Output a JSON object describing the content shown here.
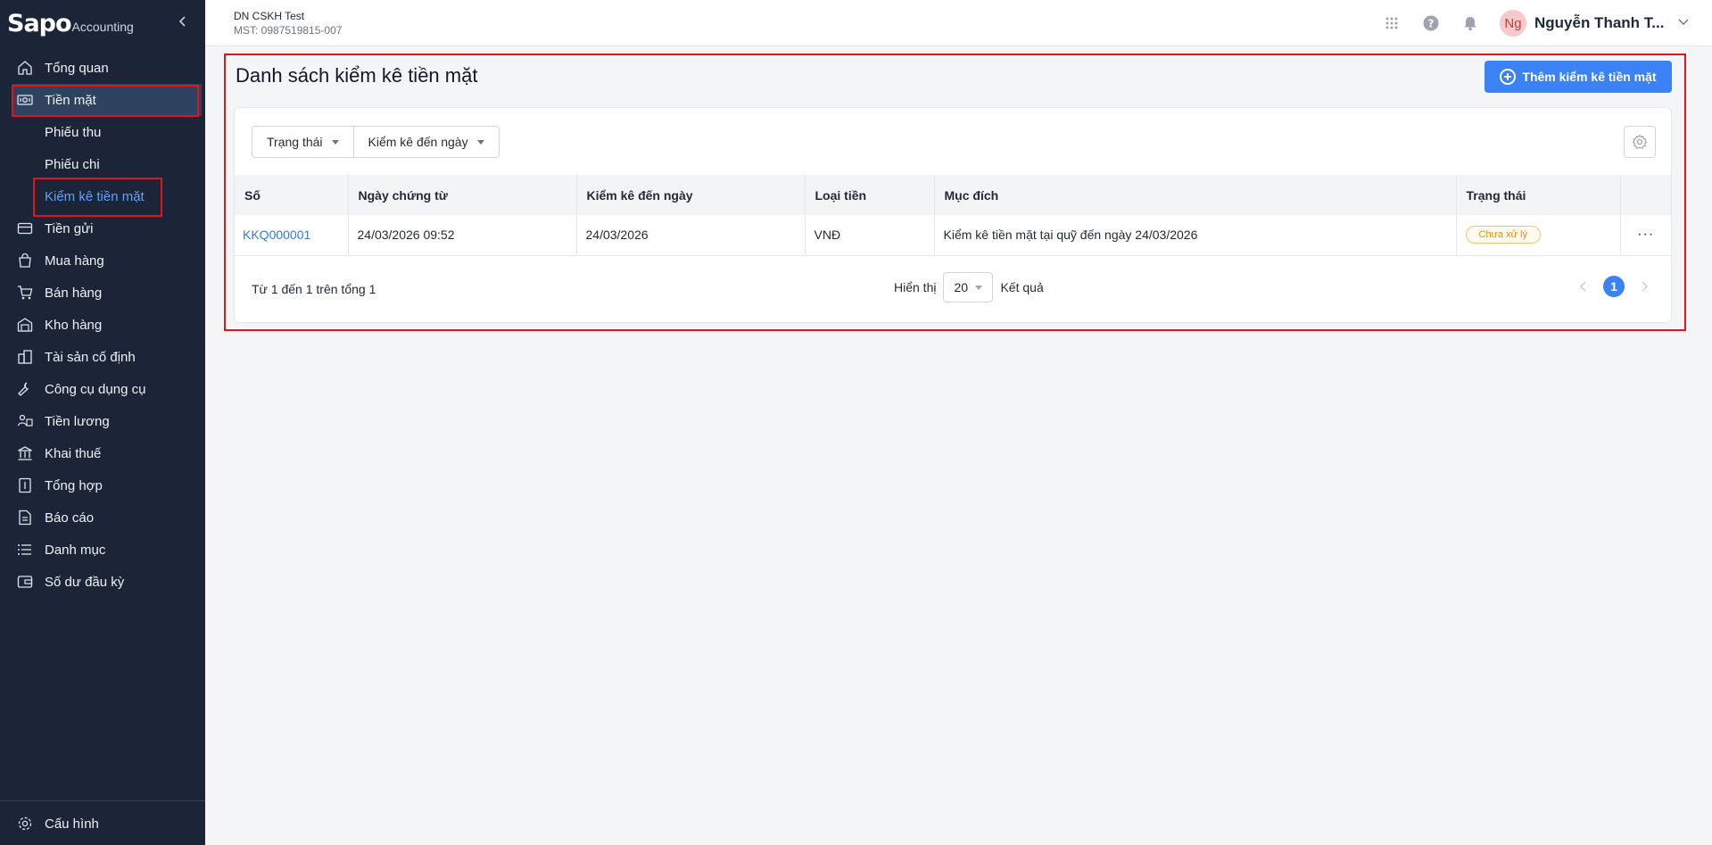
{
  "brand": {
    "logo": "Sapo",
    "sub": "Accounting"
  },
  "sidebar": {
    "items": [
      {
        "label": "Tổng quan"
      },
      {
        "label": "Tiền mặt"
      },
      {
        "label": "Tiền gửi"
      },
      {
        "label": "Mua hàng"
      },
      {
        "label": "Bán hàng"
      },
      {
        "label": "Kho hàng"
      },
      {
        "label": "Tài sản cố định"
      },
      {
        "label": "Công cụ dụng cụ"
      },
      {
        "label": "Tiền lương"
      },
      {
        "label": "Khai thuế"
      },
      {
        "label": "Tổng hợp"
      },
      {
        "label": "Báo cáo"
      },
      {
        "label": "Danh mục"
      },
      {
        "label": "Số dư đầu kỳ"
      }
    ],
    "sub_items": [
      {
        "label": "Phiếu thu"
      },
      {
        "label": "Phiếu chi"
      },
      {
        "label": "Kiểm kê tiền mặt"
      }
    ],
    "config": "Cấu hình"
  },
  "header": {
    "company_name": "DN CSKH Test",
    "company_tax": "MST: 0987519815-007",
    "avatar_initials": "Ng",
    "user_name": "Nguyễn Thanh T..."
  },
  "page": {
    "title": "Danh sách kiểm kê tiền mặt",
    "add_button": "Thêm kiểm kê tiền mặt"
  },
  "filters": {
    "status": "Trạng thái",
    "date": "Kiểm kê đến ngày"
  },
  "table": {
    "headers": [
      "Số",
      "Ngày chứng từ",
      "Kiểm kê đến ngày",
      "Loại tiền",
      "Mục đích",
      "Trạng thái"
    ],
    "rows": [
      {
        "code": "KKQ000001",
        "doc_date": "24/03/2026 09:52",
        "to_date": "24/03/2026",
        "currency": "VNĐ",
        "purpose": "Kiểm kê tiền mặt tại quỹ đến ngày 24/03/2026",
        "status": "Chưa xử lý",
        "more": "···"
      }
    ]
  },
  "pagination": {
    "summary": "Từ 1 đến 1 trên tổng 1",
    "show_label": "Hiển thị",
    "page_size": "20",
    "result_label": "Kết quả",
    "current_page": "1"
  },
  "colors": {
    "sidebar": "#1b2537",
    "accent": "#3b82f6",
    "highlight": "#e3131b"
  }
}
